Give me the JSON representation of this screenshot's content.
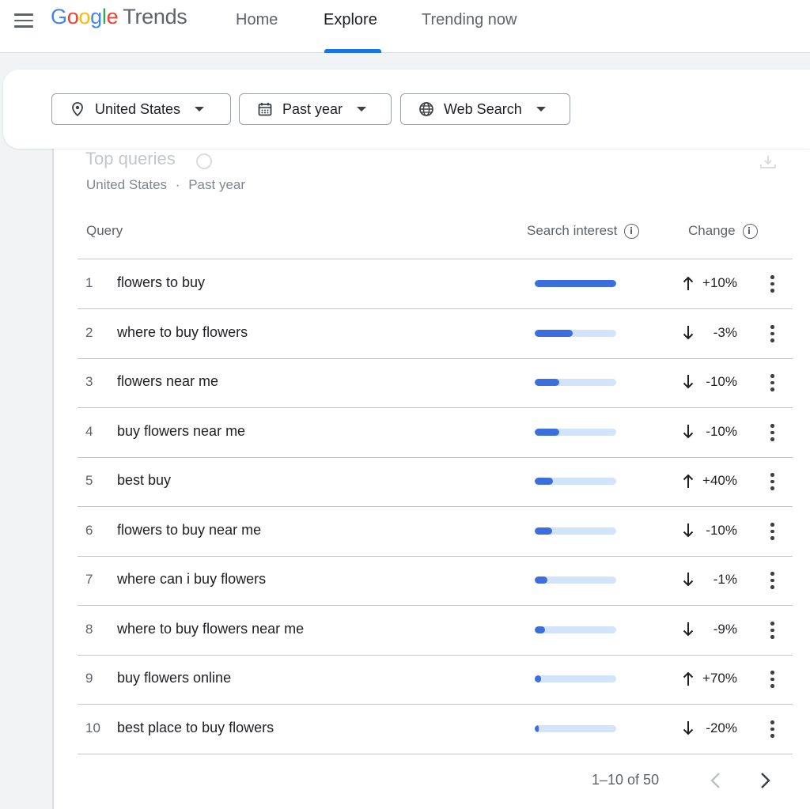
{
  "header": {
    "logo_letters": [
      "G",
      "o",
      "o",
      "g",
      "l",
      "e"
    ],
    "logo_suffix": "Trends",
    "tabs": [
      {
        "label": "Home",
        "active": false
      },
      {
        "label": "Explore",
        "active": true
      },
      {
        "label": "Trending now",
        "active": false
      }
    ]
  },
  "filters": {
    "location": "United States",
    "time_range": "Past year",
    "search_type": "Web Search"
  },
  "card": {
    "title": "Top queries",
    "subtitle_location": "United States",
    "subtitle_separator": "·",
    "subtitle_time": "Past year"
  },
  "table": {
    "columns": {
      "query": "Query",
      "interest": "Search interest",
      "change": "Change"
    },
    "rows": [
      {
        "rank": "1",
        "query": "flowers to buy",
        "interest": 100,
        "direction": "up",
        "change": "+10%"
      },
      {
        "rank": "2",
        "query": "where to buy flowers",
        "interest": 47,
        "direction": "down",
        "change": "-3%"
      },
      {
        "rank": "3",
        "query": "flowers near me",
        "interest": 30,
        "direction": "down",
        "change": "-10%"
      },
      {
        "rank": "4",
        "query": "buy flowers near me",
        "interest": 30,
        "direction": "down",
        "change": "-10%"
      },
      {
        "rank": "5",
        "query": "best buy",
        "interest": 22,
        "direction": "up",
        "change": "+40%"
      },
      {
        "rank": "6",
        "query": "flowers to buy near me",
        "interest": 21,
        "direction": "down",
        "change": "-10%"
      },
      {
        "rank": "7",
        "query": "where can i buy flowers",
        "interest": 16,
        "direction": "down",
        "change": "-1%"
      },
      {
        "rank": "8",
        "query": "where to buy flowers near me",
        "interest": 13,
        "direction": "down",
        "change": "-9%"
      },
      {
        "rank": "9",
        "query": "buy flowers online",
        "interest": 8,
        "direction": "up",
        "change": "+70%"
      },
      {
        "rank": "10",
        "query": "best place to buy flowers",
        "interest": 4,
        "direction": "down",
        "change": "-20%"
      }
    ]
  },
  "pagination": {
    "range_text": "1–10 of 50"
  },
  "colors": {
    "accent": "#1a73e8",
    "bar_fill": "#3c6fdd",
    "bar_track": "#d2e3fc"
  },
  "icons": [
    "menu-icon",
    "location-pin-icon",
    "calendar-icon",
    "globe-icon",
    "dropdown-caret-icon",
    "info-icon",
    "download-icon",
    "arrow-up-icon",
    "arrow-down-icon",
    "more-vert-icon",
    "chevron-left-icon",
    "chevron-right-icon"
  ]
}
